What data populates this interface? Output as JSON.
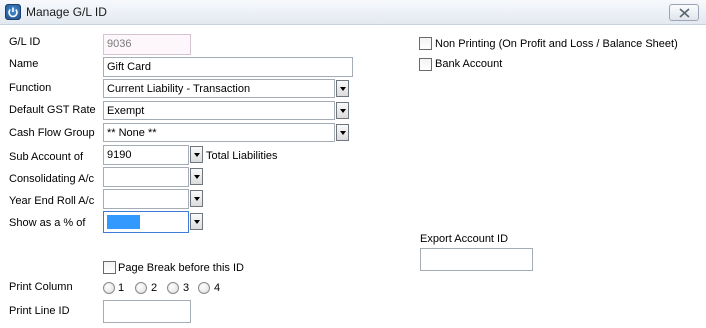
{
  "window": {
    "title": "Manage G/L ID"
  },
  "form": {
    "gl_id": {
      "label": "G/L ID",
      "value": "9036"
    },
    "name": {
      "label": "Name",
      "value": "Gift Card"
    },
    "function": {
      "label": "Function",
      "value": "Current Liability - Transaction"
    },
    "gst_rate": {
      "label": "Default GST Rate",
      "value": "Exempt"
    },
    "cash_flow_group": {
      "label": "Cash Flow Group",
      "value": "** None **"
    },
    "sub_account": {
      "label": "Sub Account of",
      "value": "9190",
      "description": "Total Liabilities"
    },
    "consolidating": {
      "label": "Consolidating A/c",
      "value": ""
    },
    "year_end_roll": {
      "label": "Year End Roll A/c",
      "value": ""
    },
    "show_as_pct": {
      "label": "Show as a % of",
      "value": ""
    },
    "page_break": {
      "label": "Page Break before this ID",
      "checked": false
    },
    "print_column": {
      "label": "Print Column",
      "options": [
        "1",
        "2",
        "3",
        "4"
      ],
      "selected": null
    },
    "print_line_id": {
      "label": "Print Line ID",
      "value": ""
    }
  },
  "right_panel": {
    "non_printing": {
      "label": "Non Printing (On Profit and Loss / Balance Sheet)",
      "checked": false
    },
    "bank_account": {
      "label": "Bank Account",
      "checked": false
    },
    "export_account_id": {
      "label": "Export Account ID",
      "value": ""
    }
  }
}
